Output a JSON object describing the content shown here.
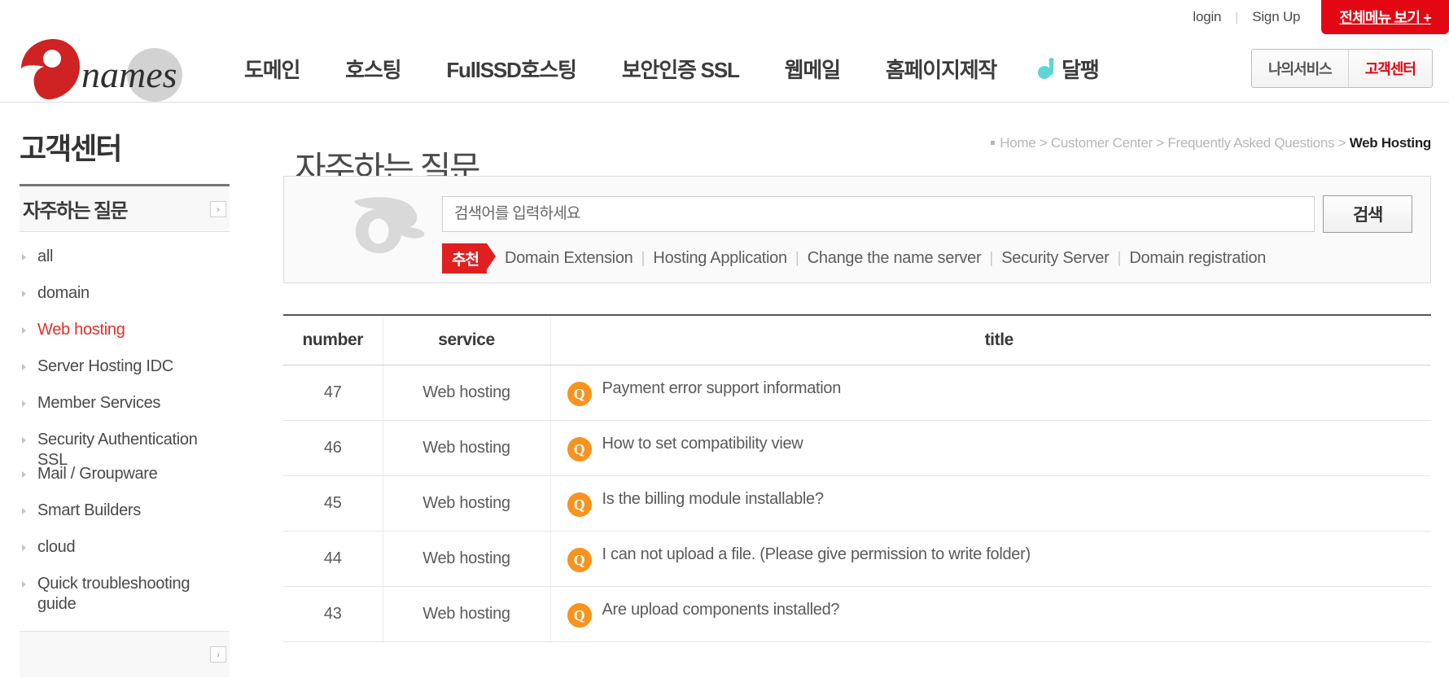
{
  "topbar": {
    "login_label": "login",
    "separator": "|",
    "signup_label": "Sign Up",
    "all_menu_label": "전체메뉴 보기 +",
    "all_menu_color": "#e30613"
  },
  "header": {
    "logo_text": "names",
    "logo_color": "#cf2222",
    "nav": [
      {
        "label": "도메인",
        "icon": ""
      },
      {
        "label": "호스팅",
        "icon": ""
      },
      {
        "label": "FullSSD호스팅",
        "icon": ""
      },
      {
        "label": "보안인증 SSL",
        "icon": ""
      },
      {
        "label": "웹메일",
        "icon": ""
      },
      {
        "label": "홈페이지제작",
        "icon": ""
      },
      {
        "label": "달팽",
        "icon": "dalpaeng-icon"
      }
    ],
    "my_service_label": "나의서비스",
    "customer_center_label": "고객센터",
    "customer_center_color": "#e30613"
  },
  "sidebar": {
    "title": "고객센터",
    "section_label": "자주하는 질문",
    "section_arrow_icon": "chevron-right-icon",
    "items": [
      {
        "label": "all",
        "active": false
      },
      {
        "label": "domain",
        "active": false
      },
      {
        "label": "Web hosting",
        "active": true
      },
      {
        "label": "Server Hosting IDC",
        "active": false
      },
      {
        "label": "Member Services",
        "active": false
      },
      {
        "label": "Security Authentication SSL",
        "active": false
      },
      {
        "label": "Mail / Groupware",
        "active": false
      },
      {
        "label": "Smart Builders",
        "active": false
      },
      {
        "label": "cloud",
        "active": false
      },
      {
        "label": "Quick troubleshooting guide",
        "active": false
      }
    ],
    "active_color": "#e03127"
  },
  "content": {
    "page_title": "자주하는 질문",
    "breadcrumb": {
      "items": [
        "Home",
        "Customer Center",
        "Frequently Asked Questions"
      ],
      "separator": ">",
      "current": "Web Hosting"
    },
    "search": {
      "icon": "magnifier-icon",
      "placeholder": "검색어를 입력하세요",
      "value": "",
      "button_label": "검색",
      "recommend_tag": "추천",
      "keywords": [
        "Domain Extension",
        "Hosting Application",
        "Change the name server",
        "Security Server",
        "Domain registration"
      ],
      "keyword_separator": "|"
    },
    "table": {
      "columns": [
        "number",
        "service",
        "title"
      ],
      "row_icon": "question-badge-icon",
      "row_icon_letter": "Q",
      "row_icon_color": "#f7931e",
      "rows": [
        {
          "number": "47",
          "service": "Web hosting",
          "title": "Payment error support information"
        },
        {
          "number": "46",
          "service": "Web hosting",
          "title": "How to set compatibility view"
        },
        {
          "number": "45",
          "service": "Web hosting",
          "title": "Is the billing module installable?"
        },
        {
          "number": "44",
          "service": "Web hosting",
          "title": "I can not upload a file. (Please give permission to write folder)"
        },
        {
          "number": "43",
          "service": "Web hosting",
          "title": "Are upload components installed?"
        }
      ]
    }
  }
}
